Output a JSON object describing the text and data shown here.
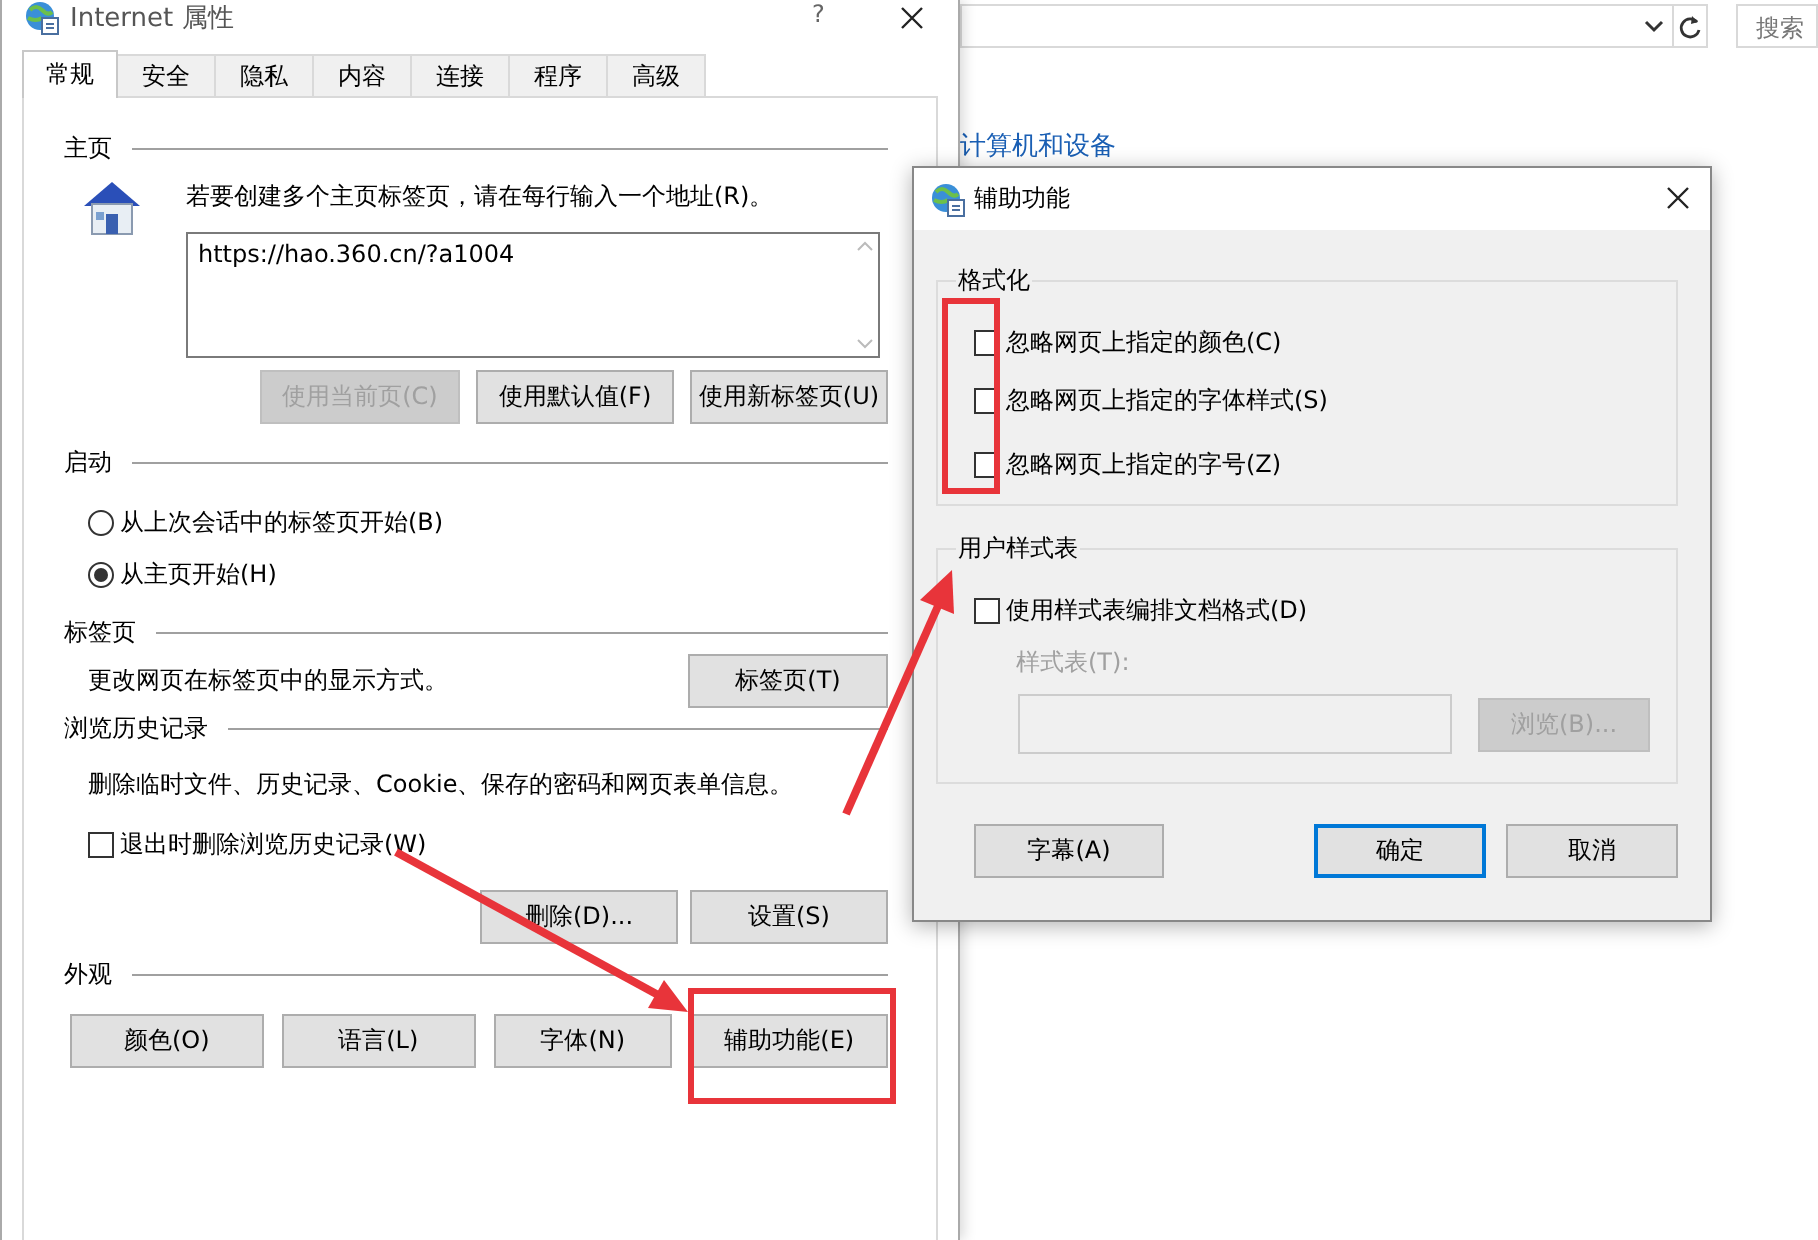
{
  "background_window": {
    "search_placeholder": "搜索",
    "link": "计算机和设备"
  },
  "internet_options": {
    "title": "Internet 属性",
    "help": "?",
    "tabs": [
      {
        "label": "常规",
        "selected": true
      },
      {
        "label": "安全",
        "selected": false
      },
      {
        "label": "隐私",
        "selected": false
      },
      {
        "label": "内容",
        "selected": false
      },
      {
        "label": "连接",
        "selected": false
      },
      {
        "label": "程序",
        "selected": false
      },
      {
        "label": "高级",
        "selected": false
      }
    ],
    "homepage": {
      "heading": "主页",
      "hint": "若要创建多个主页标签页，请在每行输入一个地址(R)。",
      "addresses": "https://hao.360.cn/?a1004",
      "buttons": [
        {
          "label": "使用当前页(C)",
          "disabled": true
        },
        {
          "label": "使用默认值(F)",
          "disabled": false
        },
        {
          "label": "使用新标签页(U)",
          "disabled": false
        }
      ]
    },
    "startup": {
      "heading": "启动",
      "options": [
        {
          "label": "从上次会话中的标签页开始(B)",
          "selected": false
        },
        {
          "label": "从主页开始(H)",
          "selected": true
        }
      ]
    },
    "tabs_section": {
      "heading": "标签页",
      "description": "更改网页在标签页中的显示方式。",
      "button": "标签页(T)"
    },
    "history": {
      "heading": "浏览历史记录",
      "description": "删除临时文件、历史记录、Cookie、保存的密码和网页表单信息。",
      "delete_on_exit": {
        "label": "退出时删除浏览历史记录(W)",
        "checked": false
      },
      "buttons": [
        "删除(D)...",
        "设置(S)"
      ]
    },
    "appearance": {
      "heading": "外观",
      "buttons": [
        "颜色(O)",
        "语言(L)",
        "字体(N)",
        "辅助功能(E)"
      ]
    }
  },
  "accessibility_dialog": {
    "title": "辅助功能",
    "formatting": {
      "heading": "格式化",
      "options": [
        {
          "label": "忽略网页上指定的颜色(C)",
          "checked": false
        },
        {
          "label": "忽略网页上指定的字体样式(S)",
          "checked": false
        },
        {
          "label": "忽略网页上指定的字号(Z)",
          "checked": false
        }
      ]
    },
    "user_style_sheet": {
      "heading": "用户样式表",
      "use": {
        "label": "使用样式表编排文档格式(D)",
        "checked": false
      },
      "style_sheet": {
        "label": "样式表(T):",
        "disabled": true
      },
      "browse": {
        "label": "浏览(B)...",
        "disabled": true
      }
    },
    "buttons": [
      {
        "label": "字幕(A)",
        "default": false
      },
      {
        "label": "确定",
        "default": true
      },
      {
        "label": "取消",
        "default": false
      }
    ]
  }
}
